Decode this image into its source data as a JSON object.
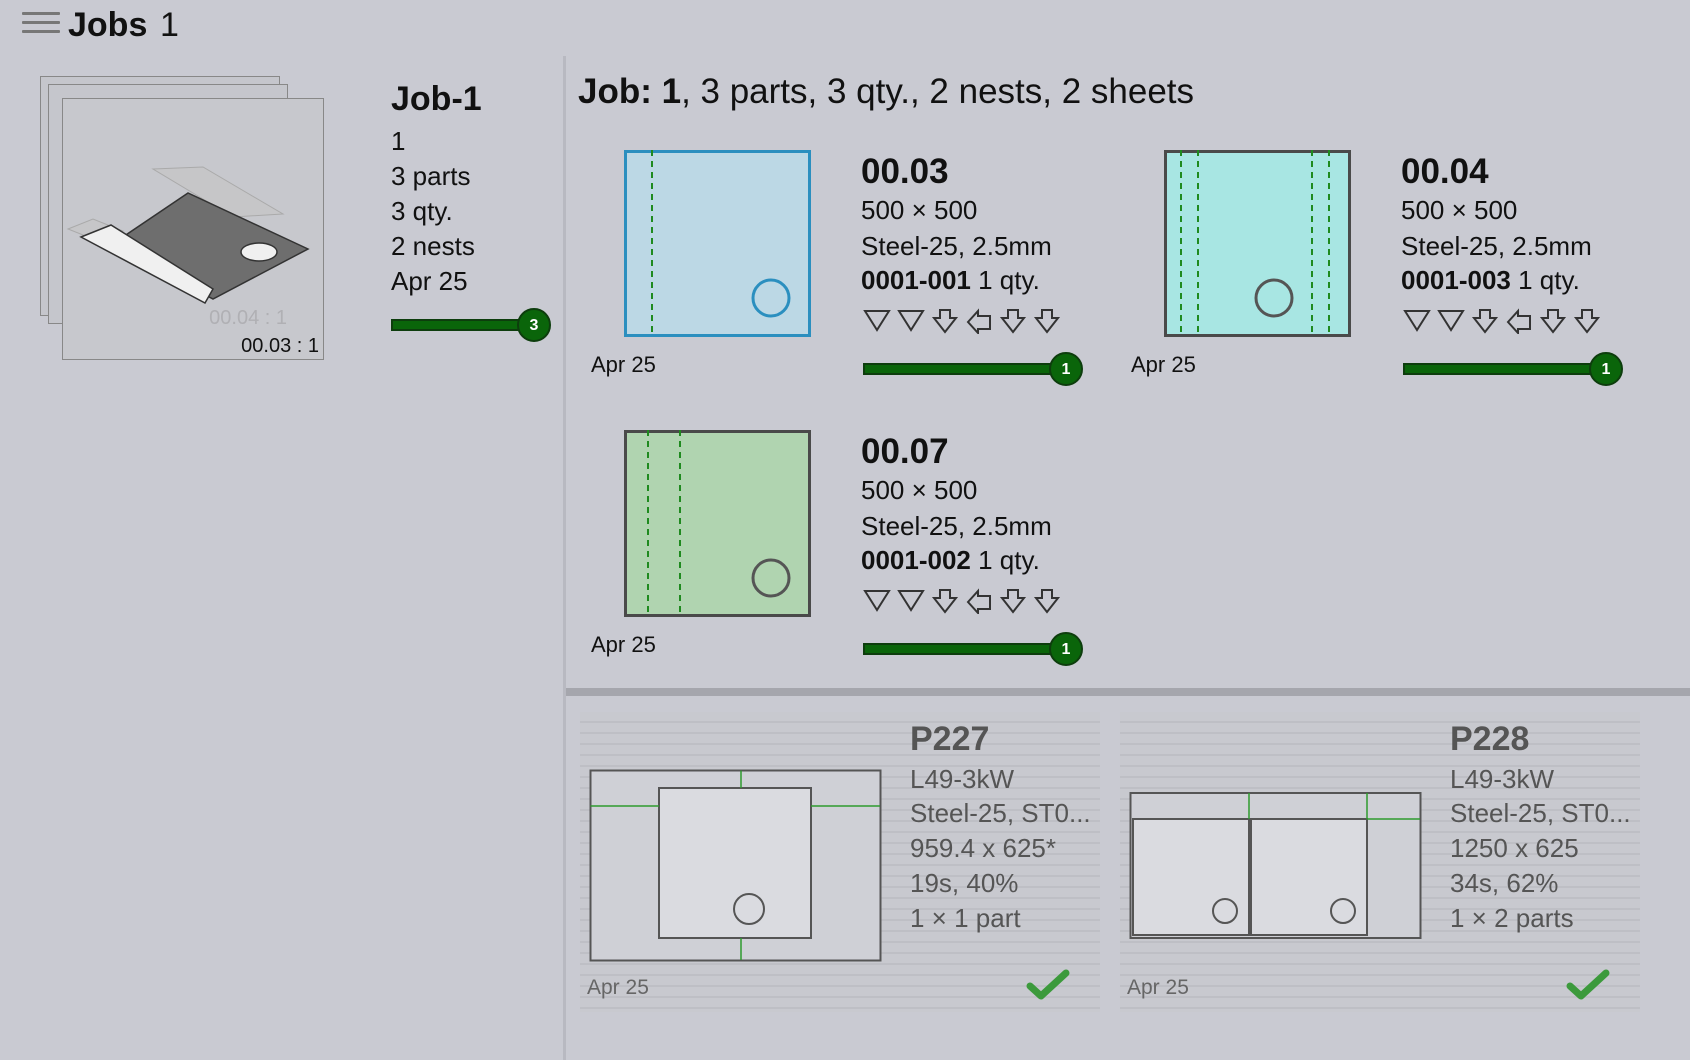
{
  "header": {
    "title": "Jobs",
    "count": "1"
  },
  "job_thumb": {
    "back_label": "00.04 : 1",
    "front_label": "00.03 : 1"
  },
  "job": {
    "name": "Job-1",
    "number": "1",
    "parts": "3 parts",
    "qty": "3 qty.",
    "nests": "2 nests",
    "date": "Apr 25",
    "progress_badge": "3",
    "progress_fraction": 1.0
  },
  "summary": {
    "prefix": "Job: 1",
    "rest": ", 3 parts, 3 qty., 2 nests, 2 sheets"
  },
  "parts": [
    {
      "title": "00.03",
      "size": "500 × 500",
      "material": "Steel-25, 2.5mm",
      "code": "0001-001",
      "qty": "1 qty.",
      "date": "Apr 25",
      "badge": "1",
      "progress_fraction": 1.0,
      "color": "#bcd8e5",
      "border": "#2b8fbf"
    },
    {
      "title": "00.04",
      "size": "500 × 500",
      "material": "Steel-25, 2.5mm",
      "code": "0001-003",
      "qty": "1 qty.",
      "date": "Apr 25",
      "badge": "1",
      "progress_fraction": 1.0,
      "color": "#a8e6e3",
      "border": "#4a4a4a"
    },
    {
      "title": "00.07",
      "size": "500 × 500",
      "material": "Steel-25, 2.5mm",
      "code": "0001-002",
      "qty": "1 qty.",
      "date": "Apr 25",
      "badge": "1",
      "progress_fraction": 1.0,
      "color": "#b0d4b0",
      "border": "#4a4a4a"
    }
  ],
  "op_icons": [
    "bend-down-icon",
    "bend-down-icon",
    "bend-arrow-down-icon",
    "bend-arrow-left-icon",
    "bend-arrow-down-icon",
    "bend-arrow-down-icon"
  ],
  "nests": [
    {
      "title": "P227",
      "machine": "L49-3kW",
      "material": "Steel-25, ST0...",
      "size": "959.4 x 625*",
      "time": "19s, 40%",
      "parts": "1 × 1 part",
      "date": "Apr 25",
      "status": "done"
    },
    {
      "title": "P228",
      "machine": "L49-3kW",
      "material": "Steel-25, ST0...",
      "size": "1250 x 625",
      "time": "34s, 62%",
      "parts": "1 × 2 parts",
      "date": "Apr 25",
      "status": "done"
    }
  ],
  "colors": {
    "progress": "#0a650a",
    "check": "#3c9a3c",
    "fold_line": "#1f8a1f"
  }
}
